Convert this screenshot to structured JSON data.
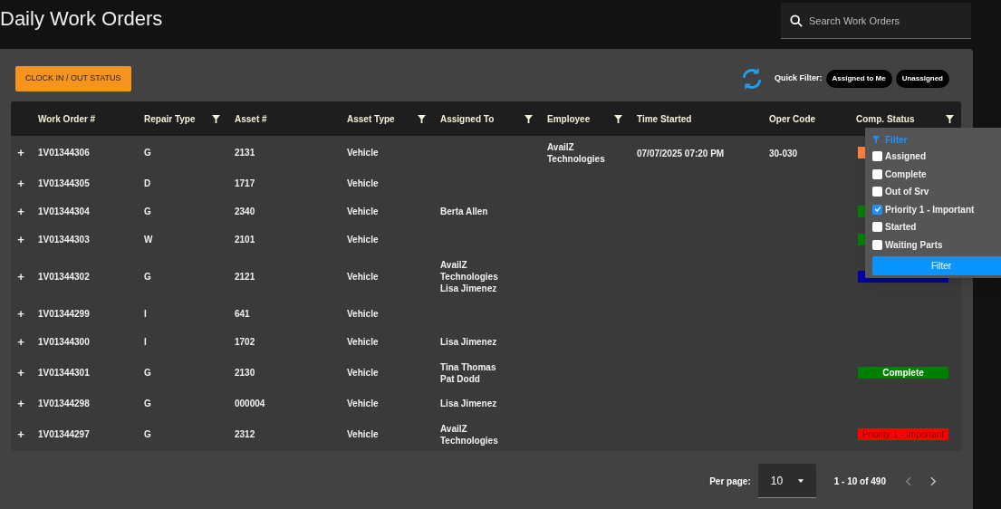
{
  "title": "Daily Work Orders",
  "search": {
    "placeholder": "Search Work Orders"
  },
  "toolbar": {
    "clock_button": "CLOCK IN / OUT STATUS",
    "quick_filter_label": "Quick Filter:",
    "quick_filters": [
      "Assigned to Me",
      "Unassigned"
    ]
  },
  "table": {
    "columns": [
      {
        "label": "Work Order #",
        "filter": false
      },
      {
        "label": "Repair Type",
        "filter": true
      },
      {
        "label": "Asset #",
        "filter": false
      },
      {
        "label": "Asset Type",
        "filter": true
      },
      {
        "label": "Assigned To",
        "filter": true
      },
      {
        "label": "Employee",
        "filter": true
      },
      {
        "label": "Time Started",
        "filter": false
      },
      {
        "label": "Oper Code",
        "filter": false
      },
      {
        "label": "Comp. Status",
        "filter": true
      }
    ],
    "expand_symbol": "+",
    "rows": [
      {
        "work_order": "1V01344306",
        "repair_type": "G",
        "asset": "2131",
        "asset_type": "Vehicle",
        "assigned_to": [],
        "employee": [
          "AvailZ",
          "Technologies"
        ],
        "time_started": "07/07/2025 07:20 PM",
        "oper_code": "30-030",
        "status": {
          "color": "#ff7f3f"
        }
      },
      {
        "work_order": "1V01344305",
        "repair_type": "D",
        "asset": "1717",
        "asset_type": "Vehicle",
        "assigned_to": [],
        "employee": []
      },
      {
        "work_order": "1V01344304",
        "repair_type": "G",
        "asset": "2340",
        "asset_type": "Vehicle",
        "assigned_to": [
          "Berta Allen"
        ],
        "employee": [],
        "status": {
          "color": "#008000"
        }
      },
      {
        "work_order": "1V01344303",
        "repair_type": "W",
        "asset": "2101",
        "asset_type": "Vehicle",
        "assigned_to": [],
        "employee": [],
        "status": {
          "color": "#008000"
        }
      },
      {
        "work_order": "1V01344302",
        "repair_type": "G",
        "asset": "2121",
        "asset_type": "Vehicle",
        "assigned_to": [
          "AvailZ",
          "Technologies",
          "Lisa Jimenez"
        ],
        "employee": [],
        "status": {
          "color": "#0000a8"
        }
      },
      {
        "work_order": "1V01344299",
        "repair_type": "I",
        "asset": "641",
        "asset_type": "Vehicle",
        "assigned_to": [],
        "employee": []
      },
      {
        "work_order": "1V01344300",
        "repair_type": "I",
        "asset": "1702",
        "asset_type": "Vehicle",
        "assigned_to": [
          "Lisa Jimenez"
        ],
        "employee": []
      },
      {
        "work_order": "1V01344301",
        "repair_type": "G",
        "asset": "2130",
        "asset_type": "Vehicle",
        "assigned_to": [
          "Tina Thomas",
          "Pat Dodd"
        ],
        "employee": [],
        "status": {
          "color": "#008000",
          "label": "Complete"
        }
      },
      {
        "work_order": "1V01344298",
        "repair_type": "G",
        "asset": "000004",
        "asset_type": "Vehicle",
        "assigned_to": [
          "Lisa Jimenez"
        ],
        "employee": []
      },
      {
        "work_order": "1V01344297",
        "repair_type": "G",
        "asset": "2312",
        "asset_type": "Vehicle",
        "assigned_to": [
          "AvailZ",
          "Technologies"
        ],
        "employee": [],
        "status": {
          "color": "#ff0000",
          "label": "Priority 1 - Important"
        }
      }
    ]
  },
  "filter_popup": {
    "title": "Filter",
    "options": [
      {
        "label": "Assigned",
        "checked": false
      },
      {
        "label": "Complete",
        "checked": false
      },
      {
        "label": "Out of Srv",
        "checked": false
      },
      {
        "label": "Priority 1 - Important",
        "checked": true
      },
      {
        "label": "Started",
        "checked": false
      },
      {
        "label": "Waiting Parts",
        "checked": false
      }
    ],
    "button": "Filter"
  },
  "pagination": {
    "per_page_label": "Per page:",
    "per_page": "10",
    "range": "1 - 10 of 490"
  }
}
